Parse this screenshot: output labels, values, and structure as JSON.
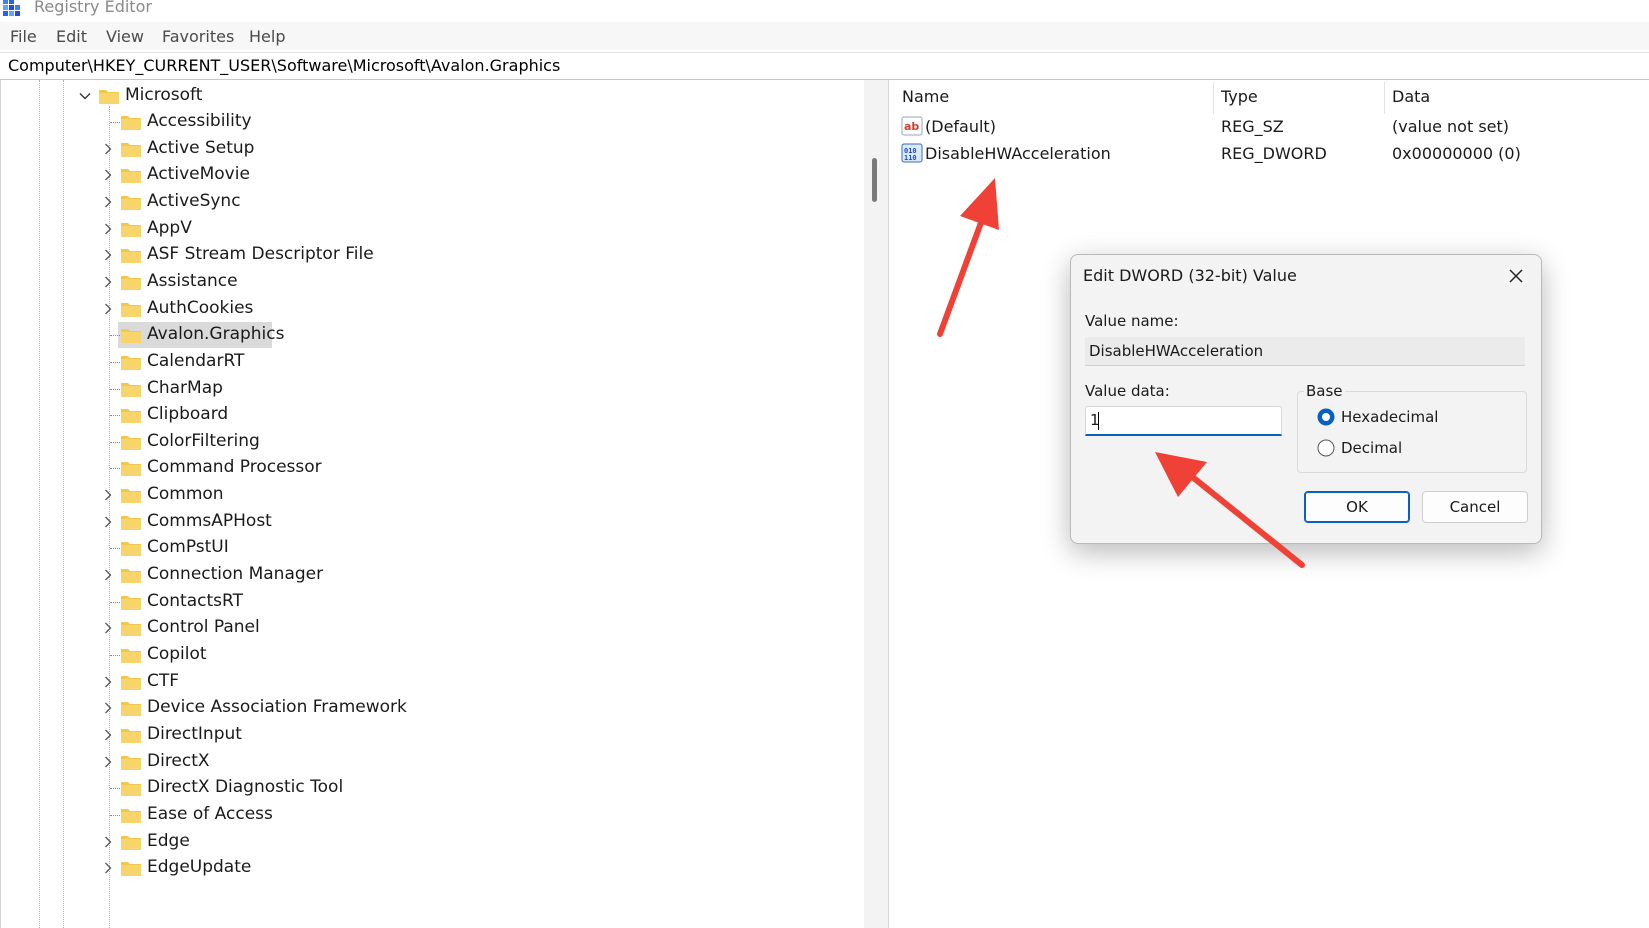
{
  "window": {
    "title": "Registry Editor",
    "icon": "registry-editor-icon"
  },
  "menu": [
    "File",
    "Edit",
    "View",
    "Favorites",
    "Help"
  ],
  "address": {
    "path": "Computer\\HKEY_CURRENT_USER\\Software\\Microsoft\\Avalon.Graphics"
  },
  "tree": {
    "parent": {
      "label": "Microsoft",
      "expanded": true
    },
    "children": [
      {
        "label": "Accessibility",
        "expandable": false
      },
      {
        "label": "Active Setup",
        "expandable": true
      },
      {
        "label": "ActiveMovie",
        "expandable": true
      },
      {
        "label": "ActiveSync",
        "expandable": true
      },
      {
        "label": "AppV",
        "expandable": true
      },
      {
        "label": "ASF Stream Descriptor File",
        "expandable": true
      },
      {
        "label": "Assistance",
        "expandable": true
      },
      {
        "label": "AuthCookies",
        "expandable": true
      },
      {
        "label": "Avalon.Graphics",
        "expandable": false,
        "selected": true
      },
      {
        "label": "CalendarRT",
        "expandable": false
      },
      {
        "label": "CharMap",
        "expandable": false
      },
      {
        "label": "Clipboard",
        "expandable": false
      },
      {
        "label": "ColorFiltering",
        "expandable": false
      },
      {
        "label": "Command Processor",
        "expandable": false
      },
      {
        "label": "Common",
        "expandable": true
      },
      {
        "label": "CommsAPHost",
        "expandable": true
      },
      {
        "label": "ComPstUI",
        "expandable": false
      },
      {
        "label": "Connection Manager",
        "expandable": true
      },
      {
        "label": "ContactsRT",
        "expandable": false
      },
      {
        "label": "Control Panel",
        "expandable": true
      },
      {
        "label": "Copilot",
        "expandable": false
      },
      {
        "label": "CTF",
        "expandable": true
      },
      {
        "label": "Device Association Framework",
        "expandable": true
      },
      {
        "label": "DirectInput",
        "expandable": true
      },
      {
        "label": "DirectX",
        "expandable": true
      },
      {
        "label": "DirectX Diagnostic Tool",
        "expandable": false
      },
      {
        "label": "Ease of Access",
        "expandable": false
      },
      {
        "label": "Edge",
        "expandable": true
      },
      {
        "label": "EdgeUpdate",
        "expandable": true
      }
    ]
  },
  "list": {
    "columns": [
      "Name",
      "Type",
      "Data"
    ],
    "rows": [
      {
        "icon": "string-value-icon",
        "name": "(Default)",
        "type": "REG_SZ",
        "data": "(value not set)"
      },
      {
        "icon": "binary-value-icon",
        "name": "DisableHWAcceleration",
        "type": "REG_DWORD",
        "data": "0x00000000 (0)"
      }
    ]
  },
  "dialog": {
    "title": "Edit DWORD (32-bit) Value",
    "value_name_label": "Value name:",
    "value_name": "DisableHWAcceleration",
    "value_data_label": "Value data:",
    "value_data": "1",
    "base_label": "Base",
    "base_options": [
      {
        "label": "Hexadecimal",
        "selected": true
      },
      {
        "label": "Decimal",
        "selected": false
      }
    ],
    "ok_label": "OK",
    "cancel_label": "Cancel"
  },
  "colors": {
    "accent": "#0a5fc4",
    "folder": "#f2c94c",
    "selection": "#dadada",
    "annotation_arrow": "#ef4136"
  }
}
